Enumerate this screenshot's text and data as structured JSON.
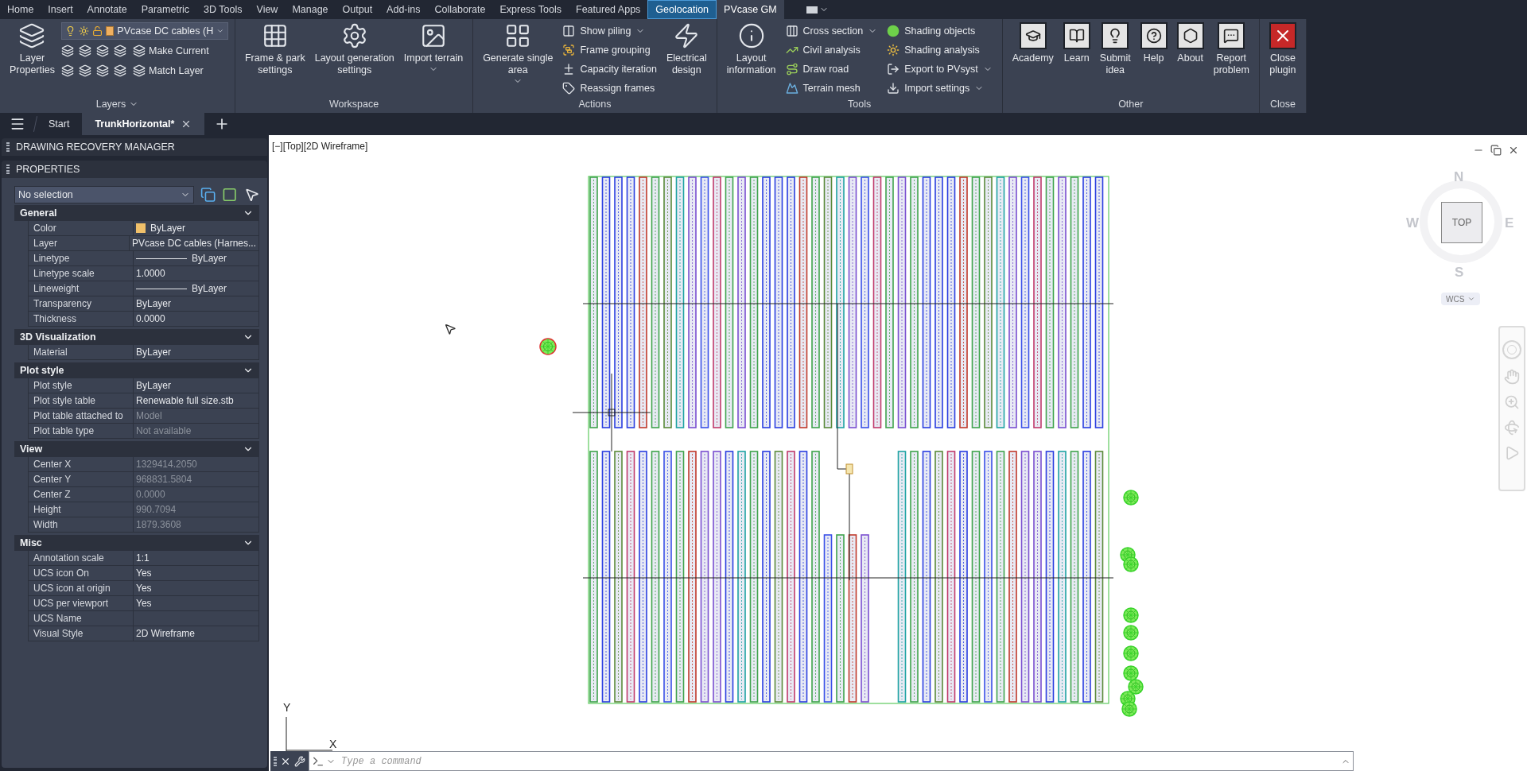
{
  "menu_tabs": [
    {
      "label": "Home",
      "kind": "normal",
      "selected": false
    },
    {
      "label": "Insert",
      "kind": "normal",
      "selected": false
    },
    {
      "label": "Annotate",
      "kind": "normal",
      "selected": false
    },
    {
      "label": "Parametric",
      "kind": "normal",
      "selected": false
    },
    {
      "label": "3D Tools",
      "kind": "normal",
      "selected": false
    },
    {
      "label": "View",
      "kind": "normal",
      "selected": false
    },
    {
      "label": "Manage",
      "kind": "normal",
      "selected": false
    },
    {
      "label": "Output",
      "kind": "normal",
      "selected": false
    },
    {
      "label": "Add-ins",
      "kind": "normal",
      "selected": false
    },
    {
      "label": "Collaborate",
      "kind": "normal",
      "selected": false
    },
    {
      "label": "Express Tools",
      "kind": "normal",
      "selected": false
    },
    {
      "label": "Featured Apps",
      "kind": "normal",
      "selected": false
    },
    {
      "label": "Geolocation",
      "kind": "contextual",
      "selected": false
    },
    {
      "label": "PVcase GM",
      "kind": "normal",
      "selected": true
    }
  ],
  "ribbon_panels": [
    {
      "title": "Layers",
      "menu": true,
      "items": [
        {
          "kind": "large",
          "label": "Layer\nProperties",
          "dropdown": false
        },
        {
          "kind": "layers",
          "combo": "PVcase DC cables (H",
          "actions": [
            "Make Current",
            "Match Layer"
          ]
        }
      ]
    },
    {
      "title": "Workspace",
      "menu": false,
      "items": [
        {
          "kind": "large",
          "label": "Frame & park\nsettings",
          "dropdown": false
        },
        {
          "kind": "large",
          "label": "Layout generation\nsettings",
          "dropdown": false
        },
        {
          "kind": "large",
          "label": "Import terrain",
          "dropdown": true
        }
      ]
    },
    {
      "title": "Actions",
      "menu": false,
      "items": [
        {
          "kind": "large",
          "label": "Generate single\narea",
          "dropdown": true
        },
        {
          "kind": "stack",
          "tools": [
            {
              "label": "Show piling",
              "dropdown": true
            },
            {
              "label": "Frame grouping",
              "dropdown": false
            },
            {
              "label": "Capacity iteration",
              "dropdown": false
            },
            {
              "label": "Reassign frames",
              "dropdown": false
            }
          ]
        },
        {
          "kind": "large",
          "label": "Electrical\ndesign",
          "dropdown": false
        }
      ]
    },
    {
      "title": "Tools",
      "menu": false,
      "items": [
        {
          "kind": "large",
          "label": "Layout\ninformation",
          "dropdown": false
        },
        {
          "kind": "stack",
          "tools": [
            {
              "label": "Cross section",
              "dropdown": true
            },
            {
              "label": "Civil analysis",
              "dropdown": false
            },
            {
              "label": "Draw road",
              "dropdown": false
            },
            {
              "label": "Terrain mesh",
              "dropdown": false
            }
          ]
        },
        {
          "kind": "stack",
          "tools": [
            {
              "label": "Shading objects",
              "dropdown": false
            },
            {
              "label": "Shading analysis",
              "dropdown": false
            },
            {
              "label": "Export to PVsyst",
              "dropdown": true
            },
            {
              "label": "Import settings",
              "dropdown": true
            }
          ]
        }
      ]
    },
    {
      "title": "Other",
      "menu": false,
      "items": [
        {
          "kind": "boxed",
          "label": "Academy",
          "dropdown": false
        },
        {
          "kind": "boxed",
          "label": "Learn",
          "dropdown": false
        },
        {
          "kind": "boxed",
          "label": "Submit\nidea",
          "dropdown": false
        },
        {
          "kind": "boxed",
          "label": "Help",
          "dropdown": false
        },
        {
          "kind": "boxed",
          "label": "About",
          "dropdown": false
        },
        {
          "kind": "boxed",
          "label": "Report\nproblem",
          "dropdown": false
        }
      ]
    },
    {
      "title": "Close",
      "menu": false,
      "items": [
        {
          "kind": "danger",
          "label": "Close\nplugin",
          "dropdown": false
        }
      ]
    }
  ],
  "file_tabs": [
    {
      "label": "Start",
      "selected": false
    },
    {
      "label": "TrunkHorizontal*",
      "selected": true
    }
  ],
  "palettes": [
    "DRAWING RECOVERY MANAGER",
    "PROPERTIES"
  ],
  "properties": {
    "selection": "No selection",
    "sections": [
      {
        "title": "General",
        "expanded": true,
        "rows": [
          {
            "label": "Color",
            "value": "ByLayer",
            "kind": "color",
            "color": "#f0c06a",
            "disabled": false
          },
          {
            "label": "Layer",
            "value": "PVcase DC cables (Harnes...",
            "kind": "text",
            "disabled": false
          },
          {
            "label": "Linetype",
            "value": "ByLayer",
            "kind": "line",
            "disabled": false
          },
          {
            "label": "Linetype scale",
            "value": "1.0000",
            "kind": "text",
            "disabled": false
          },
          {
            "label": "Lineweight",
            "value": "ByLayer",
            "kind": "line",
            "disabled": false
          },
          {
            "label": "Transparency",
            "value": "ByLayer",
            "kind": "text",
            "disabled": false
          },
          {
            "label": "Thickness",
            "value": "0.0000",
            "kind": "text",
            "disabled": false
          }
        ]
      },
      {
        "title": "3D Visualization",
        "expanded": true,
        "rows": [
          {
            "label": "Material",
            "value": "ByLayer",
            "kind": "text",
            "disabled": false
          }
        ]
      },
      {
        "title": "Plot style",
        "expanded": true,
        "rows": [
          {
            "label": "Plot style",
            "value": "ByLayer",
            "kind": "text",
            "disabled": false
          },
          {
            "label": "Plot style table",
            "value": "Renewable full size.stb",
            "kind": "text",
            "disabled": false
          },
          {
            "label": "Plot table attached to",
            "value": "Model",
            "kind": "text",
            "disabled": true
          },
          {
            "label": "Plot table type",
            "value": "Not available",
            "kind": "text",
            "disabled": true
          }
        ]
      },
      {
        "title": "View",
        "expanded": true,
        "rows": [
          {
            "label": "Center X",
            "value": "1329414.2050",
            "kind": "text",
            "disabled": true
          },
          {
            "label": "Center Y",
            "value": "968831.5804",
            "kind": "text",
            "disabled": true
          },
          {
            "label": "Center Z",
            "value": "0.0000",
            "kind": "text",
            "disabled": true
          },
          {
            "label": "Height",
            "value": "990.7094",
            "kind": "text",
            "disabled": true
          },
          {
            "label": "Width",
            "value": "1879.3608",
            "kind": "text",
            "disabled": true
          }
        ]
      },
      {
        "title": "Misc",
        "expanded": true,
        "rows": [
          {
            "label": "Annotation scale",
            "value": "1:1",
            "kind": "text",
            "disabled": false
          },
          {
            "label": "UCS icon On",
            "value": "Yes",
            "kind": "text",
            "disabled": false
          },
          {
            "label": "UCS icon at origin",
            "value": "Yes",
            "kind": "text",
            "disabled": false
          },
          {
            "label": "UCS per viewport",
            "value": "Yes",
            "kind": "text",
            "disabled": false
          },
          {
            "label": "UCS Name",
            "kind": "text",
            "disabled": false
          },
          {
            "label": "Visual Style",
            "value": "2D Wireframe",
            "kind": "text",
            "disabled": false
          }
        ]
      }
    ]
  },
  "canvas": {
    "viewport_label": "[−][Top][2D Wireframe]",
    "viewcube": {
      "north": "N",
      "east": "E",
      "south": "S",
      "west": "W",
      "face": "TOP",
      "wcs": "WCS"
    },
    "ucs": {
      "x": "X",
      "y": "Y"
    },
    "command_line": {
      "placeholder": "Type a command"
    }
  }
}
